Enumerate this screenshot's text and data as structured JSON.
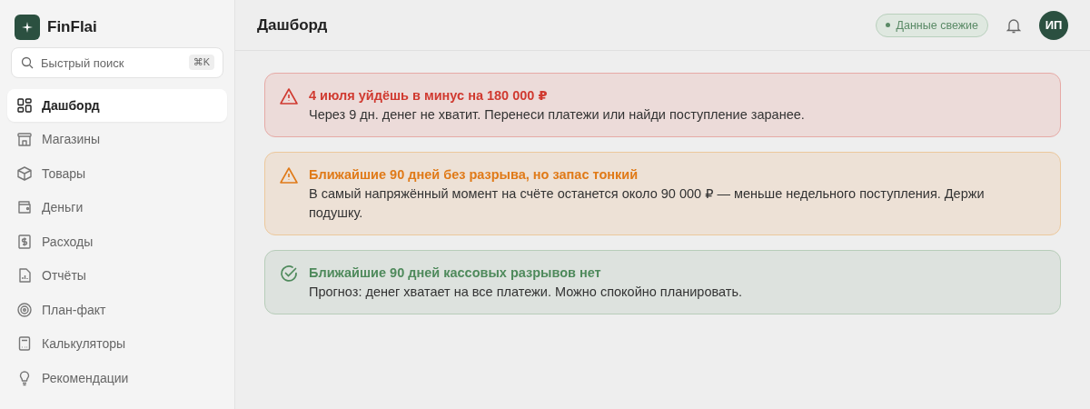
{
  "brand": {
    "name": "FinFlai"
  },
  "search": {
    "placeholder": "Быстрый поиск",
    "shortcut": "⌘K"
  },
  "sidebar": {
    "items": [
      {
        "label": "Дашборд",
        "selected": true
      },
      {
        "label": "Магазины",
        "selected": false
      },
      {
        "label": "Товары",
        "selected": false
      },
      {
        "label": "Деньги",
        "selected": false
      },
      {
        "label": "Расходы",
        "selected": false
      },
      {
        "label": "Отчёты",
        "selected": false
      },
      {
        "label": "План-факт",
        "selected": false
      },
      {
        "label": "Калькуляторы",
        "selected": false
      },
      {
        "label": "Рекомендации",
        "selected": false
      }
    ]
  },
  "header": {
    "title": "Дашборд",
    "status": "Данные свежие",
    "avatar": "ИП"
  },
  "alerts": [
    {
      "kind": "danger",
      "title": "4 июля уйдёшь в минус на 180 000 ₽",
      "text": "Через 9 дн. денег не хватит. Перенеси платежи или найди поступление заранее."
    },
    {
      "kind": "warning",
      "title": "Ближайшие 90 дней без разрыва, но запас тонкий",
      "text": "В самый напряжённый момент на счёте останется около 90 000 ₽ — меньше недельного поступления. Держи подушку."
    },
    {
      "kind": "success",
      "title": "Ближайшие 90 дней кассовых разрывов нет",
      "text": "Прогноз: денег хватает на все платежи. Можно спокойно планировать."
    }
  ]
}
